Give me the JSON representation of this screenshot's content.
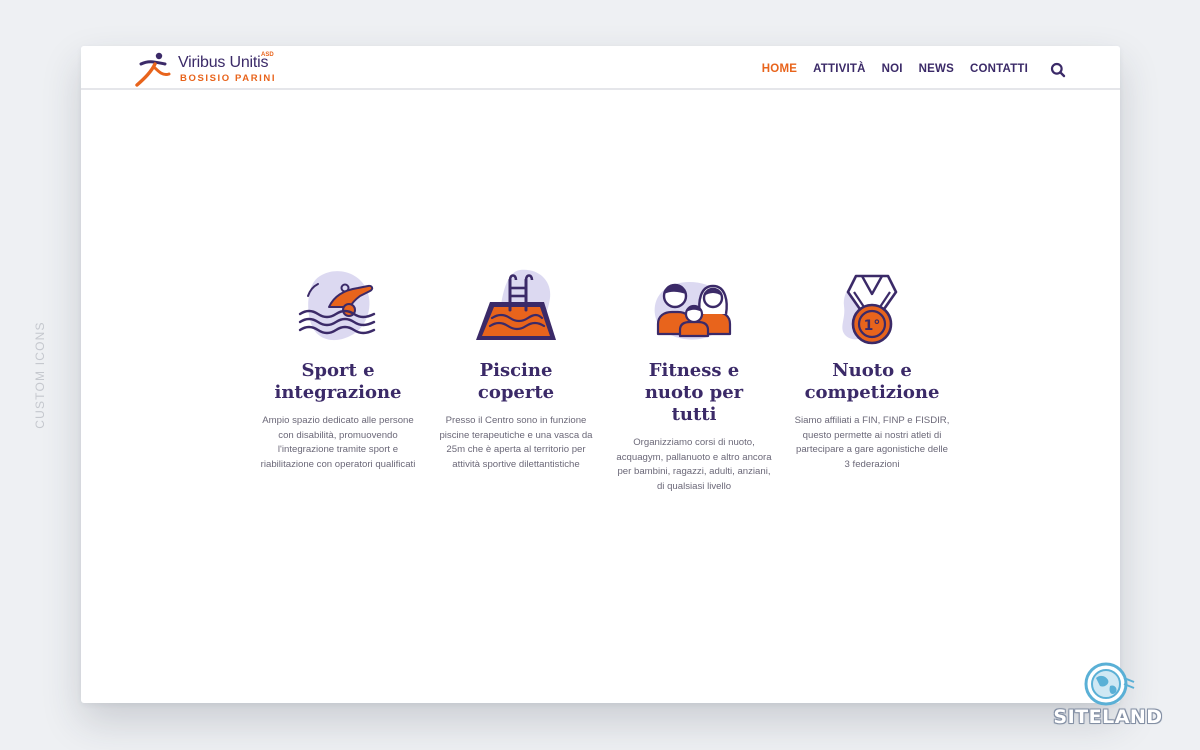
{
  "side_label": "CUSTOM ICONS",
  "logo": {
    "name": "Viribus Unitis",
    "sup": "ASD",
    "sub": "BOSISIO PARINI"
  },
  "nav": {
    "items": [
      {
        "label": "HOME",
        "active": true
      },
      {
        "label": "ATTIVITÀ",
        "active": false
      },
      {
        "label": "NOI",
        "active": false
      },
      {
        "label": "NEWS",
        "active": false
      },
      {
        "label": "CONTATTI",
        "active": false
      }
    ],
    "search_icon": "search-icon"
  },
  "colors": {
    "accent": "#e8641c",
    "brand": "#3b2a68",
    "blob": "#dcd9f1"
  },
  "features": [
    {
      "icon": "swimmer-icon",
      "title": "Sport e integrazione",
      "text": "Ampio spazio dedicato alle persone con disabilità, promuovendo l'integrazione tramite sport e riabilitazione con operatori qualificati"
    },
    {
      "icon": "pool-icon",
      "title": "Piscine coperte",
      "text": "Presso il Centro sono in funzione piscine terapeutiche e una vasca da 25m che è aperta al territorio per attività sportive dilettantistiche"
    },
    {
      "icon": "family-icon",
      "title": "Fitness e nuoto per tutti",
      "text": "Organizziamo corsi di nuoto, acquagym, pallanuoto e altro ancora per bambini, ragazzi, adulti, anziani, di qualsiasi livello"
    },
    {
      "icon": "medal-icon",
      "title": "Nuoto e competizione",
      "text": "Siamo affiliati a FIN, FINP e FISDIR, questo permette ai nostri atleti di partecipare a gare agonistiche delle 3 federazioni",
      "medal_label": "1°"
    }
  ],
  "watermark": "SITELAND"
}
